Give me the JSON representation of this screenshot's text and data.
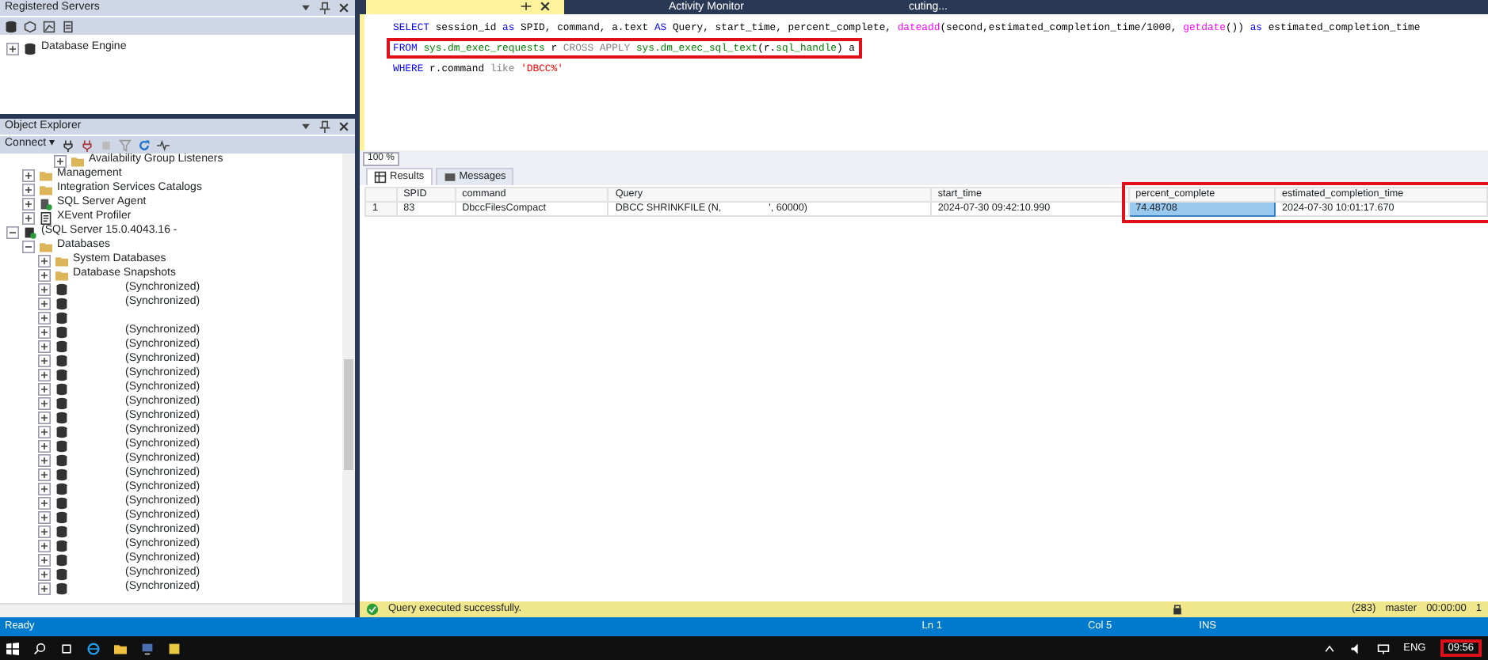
{
  "registered_servers": {
    "title": "Registered Servers",
    "tree": [
      {
        "label": "Database Engine",
        "kind": "engine",
        "expanded": false
      }
    ]
  },
  "object_explorer": {
    "title": "Object Explorer",
    "connect": "Connect ▾",
    "tree": [
      {
        "kind": "continued",
        "children": [
          {
            "kind": "continued",
            "children": [
              {
                "kind": "continued",
                "children": [
                  {
                    "label": "Availability Group Listeners",
                    "kind": "folder",
                    "expanded": false
                  }
                ]
              }
            ]
          },
          {
            "label": "Management",
            "kind": "folder",
            "expanded": false
          },
          {
            "label": "Integration Services Catalogs",
            "kind": "folder",
            "expanded": false
          },
          {
            "label": "SQL Server Agent",
            "kind": "agent",
            "expanded": false
          },
          {
            "label": "XEvent Profiler",
            "kind": "xevent",
            "expanded": false
          }
        ]
      },
      {
        "label": "(SQL Server 15.0.4043.16 -",
        "kind": "server",
        "expanded": true,
        "children": [
          {
            "label": "Databases",
            "kind": "folder",
            "expanded": true,
            "children": [
              {
                "label": "System Databases",
                "kind": "folder",
                "expanded": false
              },
              {
                "label": "Database Snapshots",
                "kind": "folder",
                "expanded": false
              },
              {
                "status": "(Synchronized)",
                "kind": "database",
                "expanded": false
              },
              {
                "status": "(Synchronized)",
                "kind": "database",
                "expanded": false
              },
              {
                "kind": "database",
                "expanded": false
              },
              {
                "status": "(Synchronized)",
                "kind": "database",
                "expanded": false
              },
              {
                "status": "(Synchronized)",
                "kind": "database",
                "expanded": false
              },
              {
                "status": "(Synchronized)",
                "kind": "database",
                "expanded": false
              },
              {
                "status": "(Synchronized)",
                "kind": "database",
                "expanded": false
              },
              {
                "status": "(Synchronized)",
                "kind": "database",
                "expanded": false
              },
              {
                "status": "(Synchronized)",
                "kind": "database",
                "expanded": false
              },
              {
                "status": "(Synchronized)",
                "kind": "database",
                "expanded": false
              },
              {
                "status": "(Synchronized)",
                "kind": "database",
                "expanded": false
              },
              {
                "status": "(Synchronized)",
                "kind": "database",
                "expanded": false
              },
              {
                "status": "(Synchronized)",
                "kind": "database",
                "expanded": false
              },
              {
                "status": "(Synchronized)",
                "kind": "database",
                "expanded": false
              },
              {
                "status": "(Synchronized)",
                "kind": "database",
                "expanded": false
              },
              {
                "status": "(Synchronized)",
                "kind": "database",
                "expanded": false
              },
              {
                "status": "(Synchronized)",
                "kind": "database",
                "expanded": false
              },
              {
                "status": "(Synchronized)",
                "kind": "database",
                "expanded": false
              },
              {
                "status": "(Synchronized)",
                "kind": "database",
                "expanded": false
              },
              {
                "status": "(Synchronized)",
                "kind": "database",
                "expanded": false
              },
              {
                "status": "(Synchronized)",
                "kind": "database",
                "expanded": false
              },
              {
                "status": "(Synchronized)",
                "kind": "database",
                "expanded": false
              }
            ]
          }
        ]
      }
    ]
  },
  "document_tabs": [
    {
      "label": "Activity Monitor",
      "selected": false
    },
    {
      "label": "cuting...",
      "selected": false
    }
  ],
  "editor": {
    "lines": [
      {
        "highlighted": false,
        "tokens": [
          {
            "text": "SELECT",
            "kind": "keyword"
          },
          {
            "text": " session_id ",
            "kind": "plain"
          },
          {
            "text": "as",
            "kind": "keyword"
          },
          {
            "text": " SPID, command, a.text ",
            "kind": "plain"
          },
          {
            "text": "AS",
            "kind": "keyword"
          },
          {
            "text": " Query, start_time, percent_complete, ",
            "kind": "plain"
          },
          {
            "text": "dateadd",
            "kind": "function"
          },
          {
            "text": "(second,estimated_completion_time/1000, ",
            "kind": "plain"
          },
          {
            "text": "getdate",
            "kind": "function"
          },
          {
            "text": "()) ",
            "kind": "plain"
          },
          {
            "text": "as",
            "kind": "keyword"
          },
          {
            "text": " estimated_completion_time",
            "kind": "plain"
          }
        ]
      },
      {
        "highlighted": true,
        "tokens": [
          {
            "text": "FROM ",
            "kind": "keyword"
          },
          {
            "text": "sys.dm_exec_requests",
            "kind": "system"
          },
          {
            "text": " r ",
            "kind": "plain"
          },
          {
            "text": "CROSS APPLY ",
            "kind": "operator"
          },
          {
            "text": "sys.dm_exec_sql_text",
            "kind": "system"
          },
          {
            "text": "(r.",
            "kind": "plain"
          },
          {
            "text": "sql_handle",
            "kind": "system"
          },
          {
            "text": ") a",
            "kind": "plain"
          }
        ]
      },
      {
        "highlighted": false,
        "tokens": [
          {
            "text": "WHERE",
            "kind": "keyword"
          },
          {
            "text": " r.command ",
            "kind": "plain"
          },
          {
            "text": "like ",
            "kind": "operator"
          },
          {
            "text": "'DBCC%'",
            "kind": "string"
          }
        ]
      }
    ]
  },
  "zoom": "100 %",
  "result_tabs": [
    {
      "label": "Results",
      "selected": true
    },
    {
      "label": "Messages",
      "selected": false
    }
  ],
  "results": {
    "columns": [
      {
        "label": "SPID",
        "highlighted": false
      },
      {
        "label": "command",
        "highlighted": false
      },
      {
        "label": "Query",
        "highlighted": false
      },
      {
        "label": "start_time",
        "highlighted": false
      },
      {
        "label": "percent_complete",
        "highlighted": true
      },
      {
        "label": "estimated_completion_time",
        "highlighted": true
      }
    ],
    "rows": [
      {
        "number": "1",
        "cells": [
          {
            "text": "83",
            "selected": false
          },
          {
            "text": "DbccFilesCompact",
            "selected": false
          },
          {
            "text": "DBCC SHRINKFILE (N,",
            "text_end": "', 60000)",
            "selected": false
          },
          {
            "text": "2024-07-30 09:42:10.990",
            "selected": false
          },
          {
            "text": "74.48708",
            "selected": true
          },
          {
            "text": "2024-07-30 10:01:17.670",
            "selected": false
          }
        ]
      }
    ]
  },
  "query_status": {
    "message": "Query executed successfully.",
    "rows": "(283)",
    "database": "master",
    "elapsed": "00:00:00",
    "count": "1"
  },
  "status_bar": {
    "state": "Ready",
    "line": "Ln 1",
    "column": "Col 5",
    "mode": "INS"
  },
  "taskbar": {
    "language": "ENG",
    "clock": "09:56",
    "clock_highlighted": true
  }
}
